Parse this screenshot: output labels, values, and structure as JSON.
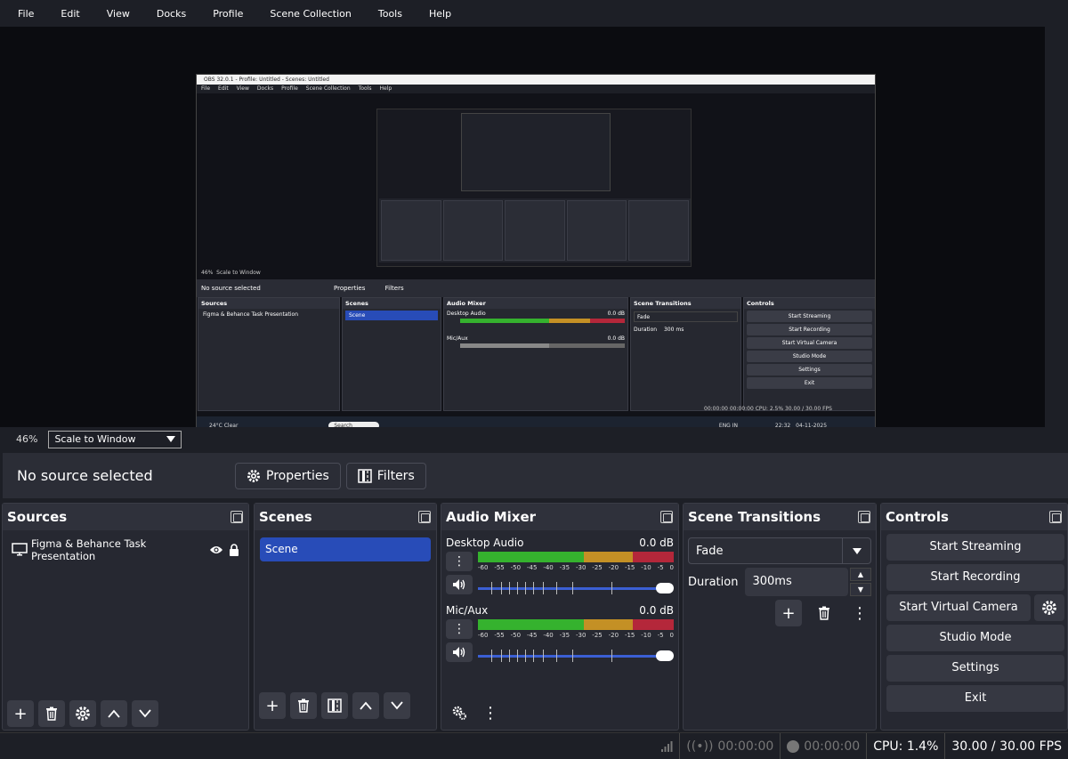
{
  "menu": [
    "File",
    "Edit",
    "View",
    "Docks",
    "Profile",
    "Scene Collection",
    "Tools",
    "Help"
  ],
  "preview": {
    "inner_title": "OBS 32.0.1 - Profile: Untitled - Scenes: Untitled",
    "inner_menu": [
      "File",
      "Edit",
      "View",
      "Docks",
      "Profile",
      "Scene Collection",
      "Tools",
      "Help"
    ],
    "inner_zoom": "46%",
    "inner_scale": "Scale to Window",
    "inner_nosource": "No source selected",
    "inner_properties": "Properties",
    "inner_filters": "Filters",
    "inner_docks": [
      "Sources",
      "Scenes",
      "Audio Mixer",
      "Scene Transitions",
      "Controls"
    ],
    "inner_source": "Figma & Behance Task Presentation",
    "inner_scene": "Scene",
    "inner_ch1": "Desktop Audio",
    "inner_ch2": "Mic/Aux",
    "inner_db": "0.0 dB",
    "inner_transition": "Fade",
    "inner_duration_label": "Duration",
    "inner_duration": "300 ms",
    "inner_controls": [
      "Start Streaming",
      "Start Recording",
      "Start Virtual Camera",
      "Studio Mode",
      "Settings",
      "Exit"
    ],
    "inner_status": "00:00:00   00:00:00   CPU: 2.5%   30.00 / 30.00 FPS",
    "taskbar_weather": "24°C Clear",
    "taskbar_search": "Search",
    "taskbar_lang": "ENG IN",
    "taskbar_time": "22:32",
    "taskbar_date": "04-11-2025"
  },
  "zoom": {
    "percent": "46%",
    "scale_mode": "Scale to Window"
  },
  "context": {
    "no_source": "No source selected",
    "properties": "Properties",
    "filters": "Filters"
  },
  "sources": {
    "title": "Sources",
    "items": [
      "Figma & Behance Task Presentation"
    ]
  },
  "scenes": {
    "title": "Scenes",
    "items": [
      "Scene"
    ]
  },
  "mixer": {
    "title": "Audio Mixer",
    "channels": [
      {
        "name": "Desktop Audio",
        "db": "0.0 dB"
      },
      {
        "name": "Mic/Aux",
        "db": "0.0 dB"
      }
    ],
    "ticks": [
      "-60",
      "-55",
      "-50",
      "-45",
      "-40",
      "-35",
      "-30",
      "-25",
      "-20",
      "-15",
      "-10",
      "-5",
      "0"
    ]
  },
  "transitions": {
    "title": "Scene Transitions",
    "selected": "Fade",
    "duration_label": "Duration",
    "duration": "300ms"
  },
  "controls": {
    "title": "Controls",
    "start_streaming": "Start Streaming",
    "start_recording": "Start Recording",
    "start_virtual_camera": "Start Virtual Camera",
    "studio_mode": "Studio Mode",
    "settings": "Settings",
    "exit": "Exit"
  },
  "status": {
    "stream_time": "00:00:00",
    "rec_time": "00:00:00",
    "cpu": "CPU: 1.4%",
    "fps": "30.00 / 30.00 FPS"
  }
}
